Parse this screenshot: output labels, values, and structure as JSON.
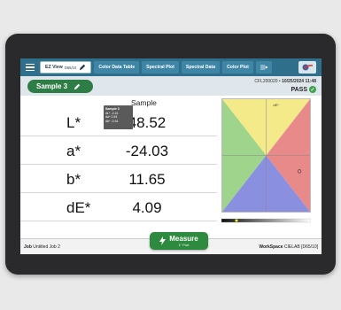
{
  "nav": {
    "active_tab": {
      "label": "EZ View",
      "sub": "D65/10"
    },
    "tabs": [
      "Color Data Table",
      "Spectral Plot",
      "Spectral Data",
      "Color Plot"
    ]
  },
  "header": {
    "sample_label": "Sample 3",
    "meta_id": "CFL200020",
    "meta_sep": " • ",
    "meta_datetime": "10/25/2024 11:48",
    "status": "PASS"
  },
  "table": {
    "column_header": "Sample",
    "rows": [
      {
        "label": "L*",
        "value": "48.52"
      },
      {
        "label": "a*",
        "value": "-24.03"
      },
      {
        "label": "b*",
        "value": "11.65"
      },
      {
        "label": "dE*",
        "value": "4.09"
      }
    ]
  },
  "plot": {
    "axis_label": "dE*",
    "tooltip_title": "Sample 3",
    "tooltip_lines": [
      "dL* -2.41",
      "da* 2.64",
      "db* -0.51"
    ],
    "colors": {
      "top": "#f5ea8a",
      "left": "#9fd48c",
      "right": "#e98a8a",
      "bottom": "#8b8fe0"
    }
  },
  "measure": {
    "label": "Measure",
    "sub": "1\" Port"
  },
  "footer": {
    "job_key": "Job",
    "job_value": "Untitled Job 2",
    "ws_key": "WorkSpace",
    "ws_value": "CIELAB [D65/10]"
  },
  "icons": [
    "menu-icon",
    "pencil-icon",
    "more-icon",
    "logo",
    "check-icon",
    "bolt-icon"
  ]
}
